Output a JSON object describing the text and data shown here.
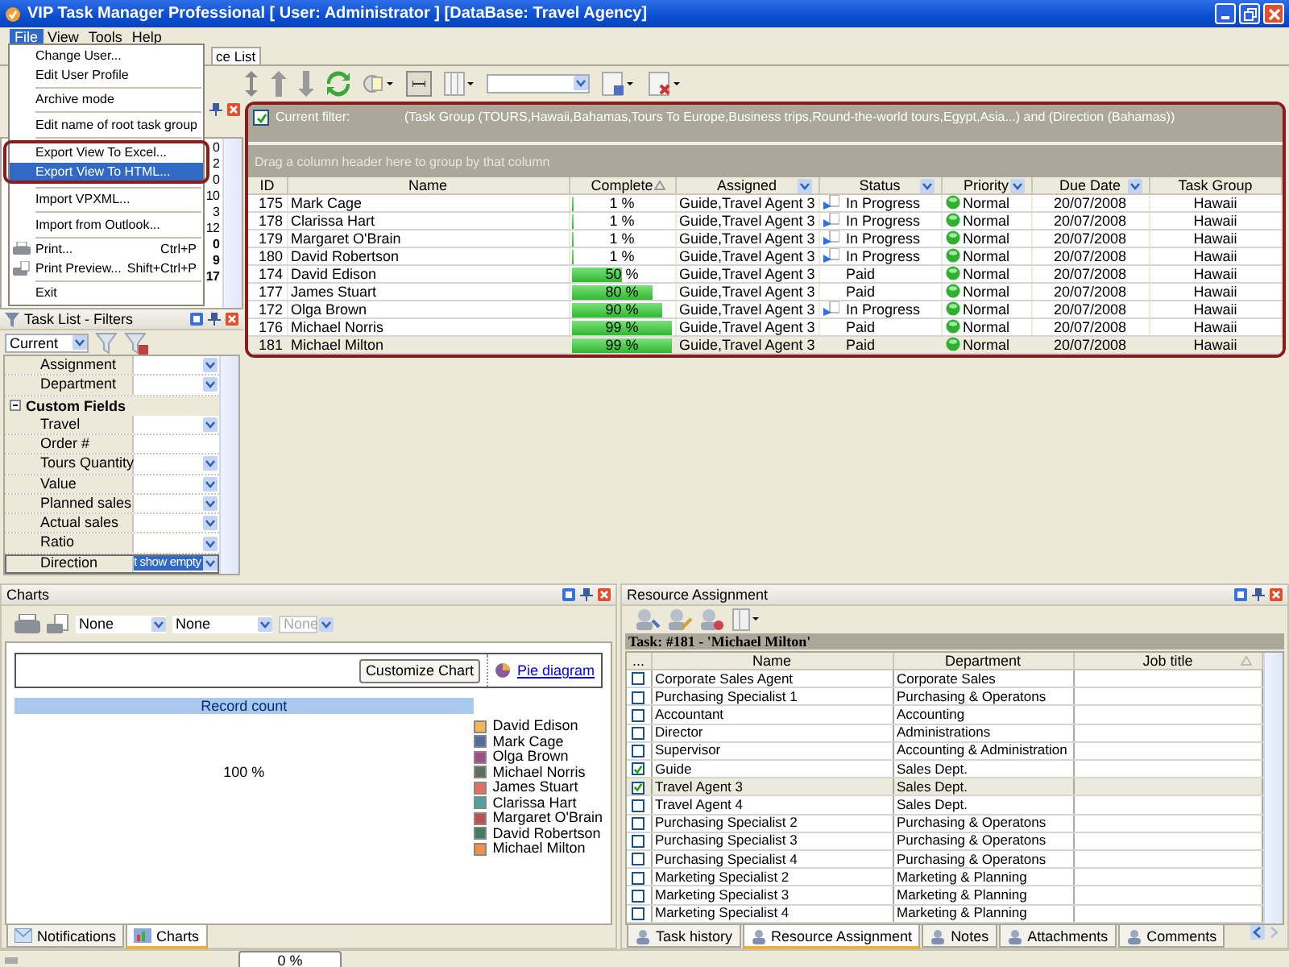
{
  "window": {
    "title": "VIP Task Manager Professional [ User: Administrator ] [DataBase: Travel Agency]"
  },
  "menu_bar": [
    {
      "label": "File",
      "selected": true
    },
    {
      "label": "View",
      "selected": false
    },
    {
      "label": "Tools",
      "selected": false
    },
    {
      "label": "Help",
      "selected": false
    }
  ],
  "file_menu": [
    {
      "kind": "item",
      "label": "Change User...",
      "selected": false,
      "outlined": false
    },
    {
      "kind": "item",
      "label": "Edit User Profile",
      "selected": false,
      "outlined": false
    },
    {
      "kind": "separator"
    },
    {
      "kind": "item",
      "label": "Archive mode",
      "selected": false,
      "outlined": false
    },
    {
      "kind": "separator"
    },
    {
      "kind": "item",
      "label": "Edit name of root task group",
      "selected": false,
      "outlined": false
    },
    {
      "kind": "separator"
    },
    {
      "kind": "item",
      "label": "Export View To Excel...",
      "selected": false,
      "outlined": true
    },
    {
      "kind": "item",
      "label": "Export View To HTML...",
      "selected": true,
      "outlined": true
    },
    {
      "kind": "separator"
    },
    {
      "kind": "item",
      "label": "Import VPXML...",
      "selected": false,
      "outlined": false
    },
    {
      "kind": "separator"
    },
    {
      "kind": "item",
      "label": "Import from Outlook...",
      "selected": false,
      "outlined": false
    },
    {
      "kind": "separator"
    },
    {
      "kind": "print",
      "label": "Print...",
      "shortcut": "Ctrl+P",
      "selected": false,
      "outlined": false
    },
    {
      "kind": "preview",
      "label": "Print Preview...",
      "shortcut": "Shift+Ctrl+P",
      "selected": false,
      "outlined": false
    },
    {
      "kind": "separator"
    },
    {
      "kind": "item",
      "label": "Exit",
      "selected": false,
      "outlined": false
    }
  ],
  "left_tab": {
    "label": "ce List"
  },
  "calendar": {
    "days": [
      {
        "label": "0",
        "bold": false
      },
      {
        "label": "2",
        "bold": false
      },
      {
        "label": "0",
        "bold": false
      },
      {
        "label": "10",
        "bold": false
      },
      {
        "label": "3",
        "bold": false
      },
      {
        "label": "12",
        "bold": false
      },
      {
        "label": "0",
        "bold": true
      },
      {
        "label": "9",
        "bold": true
      },
      {
        "label": "17",
        "bold": true
      }
    ]
  },
  "filters_panel": {
    "title": "Task List - Filters",
    "view": "Current",
    "rows": [
      {
        "kind": "field",
        "label": "Assignment",
        "dropdown": true,
        "selected": false
      },
      {
        "kind": "field",
        "label": "Department",
        "dropdown": true,
        "selected": false
      },
      {
        "kind": "category",
        "label": "Custom Fields",
        "expanded": true
      },
      {
        "kind": "field",
        "label": "Travel",
        "dropdown": true,
        "selected": false
      },
      {
        "kind": "field",
        "label": "Order #",
        "dropdown": false,
        "selected": false
      },
      {
        "kind": "field",
        "label": "Tours Quantity",
        "dropdown": true,
        "selected": false
      },
      {
        "kind": "field",
        "label": "Value",
        "dropdown": true,
        "selected": false
      },
      {
        "kind": "field",
        "label": "Planned sales",
        "dropdown": true,
        "selected": false
      },
      {
        "kind": "field",
        "label": "Actual sales",
        "dropdown": true,
        "selected": false
      },
      {
        "kind": "field",
        "label": "Ratio",
        "dropdown": true,
        "selected": false
      },
      {
        "kind": "field",
        "label": "Direction",
        "value": "t show empty",
        "dropdown": true,
        "selected": true
      }
    ]
  },
  "grid": {
    "filter": {
      "checked": true,
      "label": "Current filter:",
      "text": "(Task Group  (TOURS,Hawaii,Bahamas,Tours To Europe,Business trips,Round-the-world tours,Egypt,Asia...) and (Direction  (Bahamas))"
    },
    "group_hint": "Drag a column header here to group by that column",
    "columns": [
      {
        "label": "ID",
        "filter": false,
        "sorted": false
      },
      {
        "label": "Name",
        "filter": false,
        "sorted": false
      },
      {
        "label": "Complete",
        "filter": false,
        "sorted": true
      },
      {
        "label": "Assigned",
        "filter": true,
        "sorted": false
      },
      {
        "label": "Status",
        "filter": true,
        "sorted": false
      },
      {
        "label": "Priority",
        "filter": true,
        "sorted": false
      },
      {
        "label": "Due Date",
        "filter": true,
        "sorted": false
      },
      {
        "label": "Task Group",
        "filter": false,
        "sorted": false
      }
    ],
    "rows": [
      {
        "kind": "progress",
        "id": "175",
        "name": "Mark Cage",
        "level": 0.01,
        "complete": "1 %",
        "assigned": "Guide,Travel Agent 3",
        "status": "In Progress",
        "priority": "Normal",
        "due": "20/07/2008",
        "group": "Hawaii",
        "selected": false
      },
      {
        "kind": "progress",
        "id": "178",
        "name": "Clarissa Hart",
        "level": 0.01,
        "complete": "1 %",
        "assigned": "Guide,Travel Agent 3",
        "status": "In Progress",
        "priority": "Normal",
        "due": "20/07/2008",
        "group": "Hawaii",
        "selected": false
      },
      {
        "kind": "progress",
        "id": "179",
        "name": "Margaret O'Brain",
        "level": 0.01,
        "complete": "1 %",
        "assigned": "Guide,Travel Agent 3",
        "status": "In Progress",
        "priority": "Normal",
        "due": "20/07/2008",
        "group": "Hawaii",
        "selected": false
      },
      {
        "kind": "progress",
        "id": "180",
        "name": "David Robertson",
        "level": 0.01,
        "complete": "1 %",
        "assigned": "Guide,Travel Agent 3",
        "status": "In Progress",
        "priority": "Normal",
        "due": "20/07/2008",
        "group": "Hawaii",
        "selected": false
      },
      {
        "kind": "paid",
        "id": "174",
        "name": "David Edison",
        "level": 0.5,
        "complete": "50 %",
        "assigned": "Guide,Travel Agent 3",
        "status": "Paid",
        "priority": "Normal",
        "due": "20/07/2008",
        "group": "Hawaii",
        "selected": false
      },
      {
        "kind": "paid",
        "id": "177",
        "name": "James Stuart",
        "level": 0.8,
        "complete": "80 %",
        "assigned": "Guide,Travel Agent 3",
        "status": "Paid",
        "priority": "Normal",
        "due": "20/07/2008",
        "group": "Hawaii",
        "selected": false
      },
      {
        "kind": "progress",
        "id": "172",
        "name": "Olga Brown",
        "level": 0.9,
        "complete": "90 %",
        "assigned": "Guide,Travel Agent 3",
        "status": "In Progress",
        "priority": "Normal",
        "due": "20/07/2008",
        "group": "Hawaii",
        "selected": false
      },
      {
        "kind": "paid",
        "id": "176",
        "name": "Michael Norris",
        "level": 0.99,
        "complete": "99 %",
        "assigned": "Guide,Travel Agent 3",
        "status": "Paid",
        "priority": "Normal",
        "due": "20/07/2008",
        "group": "Hawaii",
        "selected": false
      },
      {
        "kind": "paid",
        "id": "181",
        "name": "Michael Milton",
        "level": 0.99,
        "complete": "99 %",
        "assigned": "Guide,Travel Agent 3",
        "status": "Paid",
        "priority": "Normal",
        "due": "20/07/2008",
        "group": "Hawaii",
        "selected": true
      }
    ]
  },
  "charts": {
    "title": "Charts",
    "selectors": [
      {
        "value": "None",
        "disabled": false
      },
      {
        "value": "None",
        "disabled": false
      },
      {
        "value": "None",
        "disabled": true
      }
    ],
    "customize_button": "Customize Chart",
    "pie_link": "Pie diagram",
    "header": "Record count",
    "center_label": "100 %",
    "legend": [
      {
        "label": "David Edison",
        "color": "#f0b858"
      },
      {
        "label": "Mark Cage",
        "color": "#4f6fa0"
      },
      {
        "label": "Olga Brown",
        "color": "#a04f80"
      },
      {
        "label": "Michael Norris",
        "color": "#5f6f5f"
      },
      {
        "label": "James Stuart",
        "color": "#e0705f"
      },
      {
        "label": "Clarissa Hart",
        "color": "#4fa09f"
      },
      {
        "label": "Margaret O'Brain",
        "color": "#c04f4f"
      },
      {
        "label": "David Robertson",
        "color": "#3f7f5f"
      },
      {
        "label": "Michael Milton",
        "color": "#f0904f"
      }
    ]
  },
  "charts_tabs": [
    {
      "label": "Notifications",
      "selected": false
    },
    {
      "label": "Charts",
      "selected": true
    }
  ],
  "resource": {
    "title": "Resource Assignment",
    "task_label": "Task: #181 - 'Michael Milton'",
    "columns": [
      {
        "label": "..."
      },
      {
        "label": "Name"
      },
      {
        "label": "Department"
      },
      {
        "label": "Job title"
      }
    ],
    "rows": [
      {
        "checked": false,
        "name": "Corporate Sales Agent",
        "department": "Corporate Sales",
        "selected": false
      },
      {
        "checked": false,
        "name": "Purchasing Specialist 1",
        "department": "Purchasing & Operatons",
        "selected": false
      },
      {
        "checked": false,
        "name": "Accountant",
        "department": "Accounting",
        "selected": false
      },
      {
        "checked": false,
        "name": "Director",
        "department": "Administrations",
        "selected": false
      },
      {
        "checked": false,
        "name": "Supervisor",
        "department": "Accounting & Administration",
        "selected": false
      },
      {
        "checked": true,
        "name": "Guide",
        "department": "Sales Dept.",
        "selected": false
      },
      {
        "checked": true,
        "name": "Travel Agent 3",
        "department": "Sales Dept.",
        "selected": true
      },
      {
        "checked": false,
        "name": "Travel Agent 4",
        "department": "Sales Dept.",
        "selected": false
      },
      {
        "checked": false,
        "name": "Purchasing Specialist 2",
        "department": "Purchasing & Operatons",
        "selected": false
      },
      {
        "checked": false,
        "name": "Purchasing Specialist 3",
        "department": "Purchasing & Operatons",
        "selected": false
      },
      {
        "checked": false,
        "name": "Purchasing Specialist 4",
        "department": "Purchasing & Operatons",
        "selected": false
      },
      {
        "checked": false,
        "name": "Marketing Specialist 2",
        "department": "Marketing & Planning",
        "selected": false
      },
      {
        "checked": false,
        "name": "Marketing Specialist 3",
        "department": "Marketing & Planning",
        "selected": false
      },
      {
        "checked": false,
        "name": "Marketing Specialist 4",
        "department": "Marketing & Planning",
        "selected": false
      }
    ]
  },
  "resource_tabs": [
    {
      "label": "Task history",
      "selected": false
    },
    {
      "label": "Resource Assignment",
      "selected": true
    },
    {
      "label": "Notes",
      "selected": false
    },
    {
      "label": "Attachments",
      "selected": false
    },
    {
      "label": "Comments",
      "selected": false
    }
  ],
  "status_bar": {
    "progress": "0 %"
  }
}
